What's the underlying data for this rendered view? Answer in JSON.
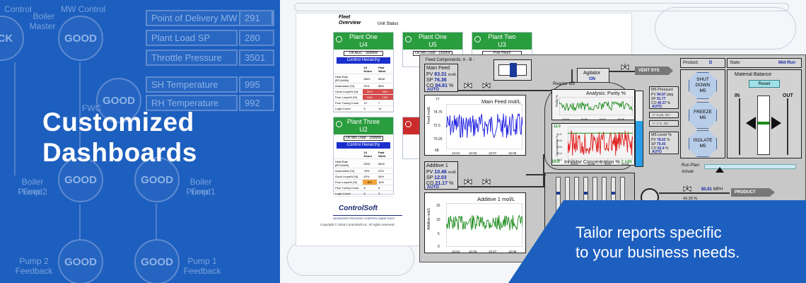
{
  "banner": {
    "headline_line1": "Customized",
    "headline_line2": "Dashboards",
    "bg_color": "#1d5fbf",
    "tagline_line1": "Tailor reports specific",
    "tagline_line2": "to your business needs."
  },
  "background_diagram": {
    "labels": [
      "Control",
      "Boiler",
      "Master",
      "MW Control",
      "FWC",
      "Boiler Feed",
      "Pump 2",
      "Boiler Feed",
      "Pump 1",
      "Pump 2",
      "Feedback",
      "Pump 1",
      "Feedback"
    ],
    "circles": [
      "ACK",
      "GOOD",
      "GOOD",
      "GOOD",
      "GOOD",
      "GOOD",
      "GOOD"
    ],
    "boxes": [
      {
        "label": "Point of Delivery MW",
        "value": "291"
      },
      {
        "label": "Plant Load  SP",
        "value": "280"
      },
      {
        "label": "Throttle Pressure",
        "value": "3501"
      },
      {
        "label": "SH Temperature",
        "value": "995"
      },
      {
        "label": "RH Temperature",
        "value": "992"
      }
    ]
  },
  "fleet": {
    "title_line1": "Fleet",
    "title_line2": "Overview",
    "subtitle": "Unit Status",
    "plants": [
      {
        "name": "Plant One",
        "unit": "U4",
        "mode": "On AGC · 300MW",
        "button": "Control Hierarchy",
        "status": "ok",
        "rows": [
          [
            "",
            "24 Hours",
            "Past Week"
          ],
          [
            "Heat Rate [BTU/kWh]",
            "8503",
            "8508"
          ],
          [
            "Automation [%]",
            "91%",
            "85%"
          ],
          [
            "Good Loops% [%]",
            "50%",
            "58%"
          ],
          [
            "Poor Loops% [%]",
            "16%",
            "16%"
          ],
          [
            "Poor Tuning Count",
            "10",
            "7"
          ],
          [
            "Login Count",
            "5",
            "12"
          ]
        ]
      },
      {
        "name": "Plant One",
        "unit": "U5",
        "mode": "On Min Load · 150MW",
        "status": "ok"
      },
      {
        "name": "Plant Two",
        "unit": "U3",
        "mode": "Post Hours",
        "status": "ok"
      },
      {
        "name": "Plant Three",
        "unit": "U2",
        "mode": "On Min Load · 105MW",
        "button": "Control Hierarchy",
        "status": "ok",
        "rows": [
          [
            "",
            "24 Hours",
            "Past Week"
          ],
          [
            "Heat Rate [BTU/kWh]",
            "8230",
            "8400"
          ],
          [
            "Automation [%]",
            "78%",
            "91%"
          ],
          [
            "Good Loops% [%]",
            "62%",
            "54%"
          ],
          [
            "Poor Loops% [%]",
            "8%",
            "16%"
          ],
          [
            "Poor Tuning Count",
            "6",
            "8"
          ],
          [
            "Login Count",
            "5",
            "3"
          ]
        ]
      },
      {
        "name": "",
        "unit": "",
        "status": "alarm"
      }
    ],
    "logo": "ControlSoft",
    "logo_tag": "ADVANCED PROCESS CONTROL MADE EASY",
    "copyright": "Copyright © 2016 ControlSoft Inc. All rights reserved."
  },
  "scada": {
    "feed_components": "Feed Components: A - B -",
    "main_feed": {
      "title": "Main Feed",
      "pv_label": "PV",
      "pv": "83.31",
      "pv_unit": "mol/L",
      "sp_label": "SP",
      "sp": "76.36",
      "co_label": "CO",
      "co": "84.81",
      "co_unit": "%",
      "mode": "AUTO"
    },
    "main_feed_chart": {
      "title": "Main Feed mol/L",
      "ylabel": "Feed mol/L",
      "y_top": "77",
      "y_ticks": [
        "74.75",
        "72.5",
        "70.25",
        "68"
      ],
      "x_ticks": [
        "10:04",
        "10:06",
        "10:07",
        "10:08"
      ]
    },
    "additive": {
      "title": "Additive 1",
      "pv_label": "PV",
      "pv": "10.46",
      "pv_unit": "mol/L",
      "sp_label": "SP",
      "sp": "12.03",
      "co_label": "CO",
      "co": "21.17",
      "co_unit": "%",
      "mode": "AUTO"
    },
    "additive_chart": {
      "title": "Additive 1 mol/L",
      "ylabel": "Additive mol/L",
      "y_ticks": [
        "15",
        "10",
        "5",
        "0"
      ],
      "x_ticks": [
        "10:04",
        "10:06",
        "10:07",
        "10:08"
      ]
    },
    "agitator": {
      "label": "Agitator",
      "state": "ON"
    },
    "vent": "VENT SYS",
    "reactor": "Reactor M5",
    "purity_chart": {
      "title": "Analysis: Purity %",
      "ylabel": "Purity %",
      "x_ticks": [
        "10:04",
        "10:06",
        "10:07",
        "10:08"
      ]
    },
    "inhibitor_chart": {
      "title": "Inhibitor Concentration %",
      "ylabel": "Concentration %",
      "y_top": "12.0",
      "y_ticks": [
        "11.0",
        "10.8",
        "10.6",
        "10.4",
        "10.2"
      ],
      "x_ticks": [
        "10:04",
        "10:06",
        "10:07",
        "10:08"
      ],
      "legend": "2 HR",
      "current": "10.0"
    },
    "m5_pressure": {
      "title": "M5 Pressure",
      "pv_label": "PV",
      "pv": "94.97",
      "pv_unit": "psig",
      "sp_label": "SP",
      "sp": "91.77",
      "co_label": "CO",
      "co": "40.37",
      "co_unit": "%",
      "mode": "AUTO"
    },
    "m5_limits": [
      "+/- 5 psi, 2hr",
      "+/- 1 %, 2hr"
    ],
    "m5_level": {
      "title": "M5 Level %",
      "pv_label": "PV",
      "pv": "78.02",
      "pv_unit": "%",
      "sp_label": "SP",
      "sp": "75.43",
      "co_label": "CO",
      "co": "52.4",
      "co_unit": "%",
      "mode": "AUTO"
    },
    "level_fill": 0.6,
    "product": {
      "label": "Product:",
      "value": "D"
    },
    "state": {
      "label": "State:",
      "value": "Mid-Run"
    },
    "material_balance": "Material Balance",
    "reset": "Reset",
    "in_label": "IN",
    "out_label": "OUT",
    "buttons": [
      {
        "label_line1": "SHUT",
        "label_line2": "DOWN",
        "label_line3": "M5"
      },
      {
        "label_line1": "FREEZE",
        "label_line2": "M5",
        "label_line3": ""
      },
      {
        "label_line1": "ISOLATE",
        "label_line2": "M5",
        "label_line3": ""
      }
    ],
    "run_plan": {
      "label_line1": "Run Plan:",
      "label_line2": "Actual"
    },
    "product_flow": {
      "value": "80.81",
      "unit": "MPH",
      "tag": "PRODUCT",
      "partial": "43.35 %"
    }
  }
}
